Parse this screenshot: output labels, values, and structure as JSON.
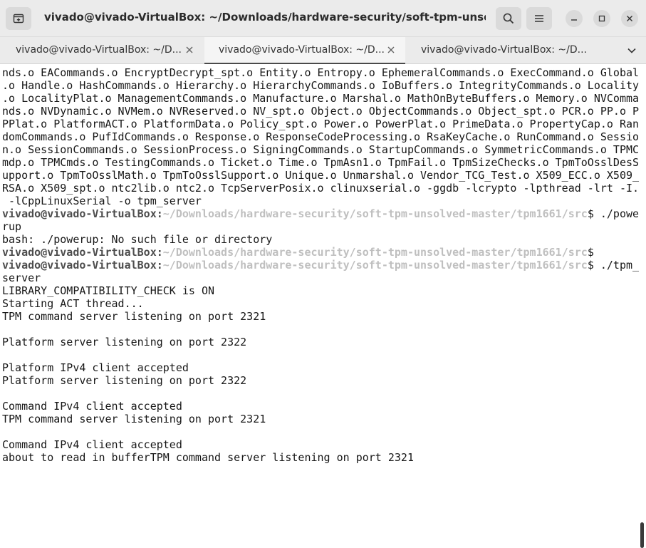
{
  "window": {
    "title": "vivado@vivado-VirtualBox: ~/Downloads/hardware-security/soft-tpm-unsolved-mast..."
  },
  "tabs": [
    {
      "label": "vivado@vivado-VirtualBox: ~/D...",
      "active": false
    },
    {
      "label": "vivado@vivado-VirtualBox: ~/D...",
      "active": true
    },
    {
      "label": "vivado@vivado-VirtualBox: ~/D...",
      "active": false
    }
  ],
  "icons": {
    "new_tab": "new-tab-icon",
    "search": "search-icon",
    "menu": "hamburger-menu-icon",
    "minimize": "minimize-icon",
    "maximize": "maximize-icon",
    "close": "close-icon",
    "tab_close": "tab-close-icon",
    "tab_dropdown": "chevron-down-icon"
  },
  "terminal": {
    "lines": [
      "nds.o EACommands.o EncryptDecrypt_spt.o Entity.o Entropy.o EphemeralCommands.o ExecCommand.o Global",
      ".o Handle.o HashCommands.o Hierarchy.o HierarchyCommands.o IoBuffers.o IntegrityCommands.o Locality",
      ".o LocalityPlat.o ManagementCommands.o Manufacture.o Marshal.o MathOnByteBuffers.o Memory.o NVComma",
      "nds.o NVDynamic.o NVMem.o NVReserved.o NV_spt.o Object.o ObjectCommands.o Object_spt.o PCR.o PP.o P",
      "PPlat.o PlatformACT.o PlatformData.o Policy_spt.o Power.o PowerPlat.o PrimeData.o PropertyCap.o Ran",
      "domCommands.o PufIdCommands.o Response.o ResponseCodeProcessing.o RsaKeyCache.o RunCommand.o Sessio",
      "n.o SessionCommands.o SessionProcess.o SigningCommands.o StartupCommands.o SymmetricCommands.o TPMC",
      "mdp.o TPMCmds.o TestingCommands.o Ticket.o Time.o TpmAsn1.o TpmFail.o TpmSizeChecks.o TpmToOsslDesS",
      "upport.o TpmToOsslMath.o TpmToOsslSupport.o Unique.o Unmarshal.o Vendor_TCG_Test.o X509_ECC.o X509_",
      "RSA.o X509_spt.o ntc2lib.o ntc2.o TcpServerPosix.o clinuxserial.o -ggdb -lcrypto -lpthread -lrt -I.",
      " -lCppLinuxSerial -o tpm_server",
      {
        "user": "vivado@vivado-VirtualBox",
        "sep": ":",
        "path": "~/Downloads/hardware-security/soft-tpm-unsolved-master/tpm1661/src",
        "cmd": "$ ./powe"
      },
      "rup",
      "bash: ./powerup: No such file or directory",
      {
        "user": "vivado@vivado-VirtualBox",
        "sep": ":",
        "path": "~/Downloads/hardware-security/soft-tpm-unsolved-master/tpm1661/src",
        "cmd": "$"
      },
      {
        "user": "vivado@vivado-VirtualBox",
        "sep": ":",
        "path": "~/Downloads/hardware-security/soft-tpm-unsolved-master/tpm1661/src",
        "cmd": "$ ./tpm_"
      },
      "server",
      "LIBRARY_COMPATIBILITY_CHECK is ON",
      "Starting ACT thread...",
      "TPM command server listening on port 2321",
      "",
      "Platform server listening on port 2322",
      "",
      "Platform IPv4 client accepted",
      "Platform server listening on port 2322",
      "",
      "Command IPv4 client accepted",
      "TPM command server listening on port 2321",
      "",
      "Command IPv4 client accepted",
      "about to read in bufferTPM command server listening on port 2321"
    ]
  },
  "colors": {
    "headerbar": "#ebebeb",
    "terminal_bg": "#ffffff",
    "text": "#171717",
    "prompt_user": "#4d4d4d",
    "prompt_path": "#bfbfbf"
  }
}
